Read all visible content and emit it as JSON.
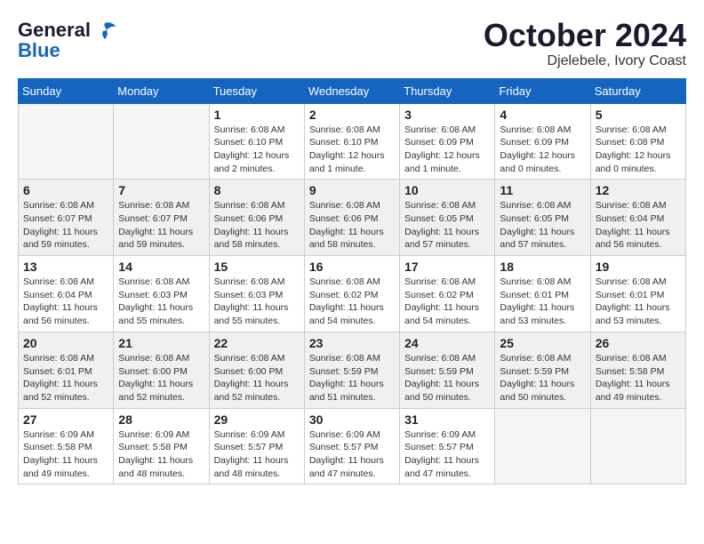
{
  "header": {
    "logo_line1": "General",
    "logo_line2": "Blue",
    "month": "October 2024",
    "location": "Djelebele, Ivory Coast"
  },
  "days_of_week": [
    "Sunday",
    "Monday",
    "Tuesday",
    "Wednesday",
    "Thursday",
    "Friday",
    "Saturday"
  ],
  "weeks": [
    [
      {
        "day": "",
        "sunrise": "",
        "sunset": "",
        "daylight": "",
        "empty": true
      },
      {
        "day": "",
        "sunrise": "",
        "sunset": "",
        "daylight": "",
        "empty": true
      },
      {
        "day": "1",
        "sunrise": "Sunrise: 6:08 AM",
        "sunset": "Sunset: 6:10 PM",
        "daylight": "Daylight: 12 hours and 2 minutes.",
        "empty": false
      },
      {
        "day": "2",
        "sunrise": "Sunrise: 6:08 AM",
        "sunset": "Sunset: 6:10 PM",
        "daylight": "Daylight: 12 hours and 1 minute.",
        "empty": false
      },
      {
        "day": "3",
        "sunrise": "Sunrise: 6:08 AM",
        "sunset": "Sunset: 6:09 PM",
        "daylight": "Daylight: 12 hours and 1 minute.",
        "empty": false
      },
      {
        "day": "4",
        "sunrise": "Sunrise: 6:08 AM",
        "sunset": "Sunset: 6:09 PM",
        "daylight": "Daylight: 12 hours and 0 minutes.",
        "empty": false
      },
      {
        "day": "5",
        "sunrise": "Sunrise: 6:08 AM",
        "sunset": "Sunset: 6:08 PM",
        "daylight": "Daylight: 12 hours and 0 minutes.",
        "empty": false
      }
    ],
    [
      {
        "day": "6",
        "sunrise": "Sunrise: 6:08 AM",
        "sunset": "Sunset: 6:07 PM",
        "daylight": "Daylight: 11 hours and 59 minutes.",
        "empty": false
      },
      {
        "day": "7",
        "sunrise": "Sunrise: 6:08 AM",
        "sunset": "Sunset: 6:07 PM",
        "daylight": "Daylight: 11 hours and 59 minutes.",
        "empty": false
      },
      {
        "day": "8",
        "sunrise": "Sunrise: 6:08 AM",
        "sunset": "Sunset: 6:06 PM",
        "daylight": "Daylight: 11 hours and 58 minutes.",
        "empty": false
      },
      {
        "day": "9",
        "sunrise": "Sunrise: 6:08 AM",
        "sunset": "Sunset: 6:06 PM",
        "daylight": "Daylight: 11 hours and 58 minutes.",
        "empty": false
      },
      {
        "day": "10",
        "sunrise": "Sunrise: 6:08 AM",
        "sunset": "Sunset: 6:05 PM",
        "daylight": "Daylight: 11 hours and 57 minutes.",
        "empty": false
      },
      {
        "day": "11",
        "sunrise": "Sunrise: 6:08 AM",
        "sunset": "Sunset: 6:05 PM",
        "daylight": "Daylight: 11 hours and 57 minutes.",
        "empty": false
      },
      {
        "day": "12",
        "sunrise": "Sunrise: 6:08 AM",
        "sunset": "Sunset: 6:04 PM",
        "daylight": "Daylight: 11 hours and 56 minutes.",
        "empty": false
      }
    ],
    [
      {
        "day": "13",
        "sunrise": "Sunrise: 6:08 AM",
        "sunset": "Sunset: 6:04 PM",
        "daylight": "Daylight: 11 hours and 56 minutes.",
        "empty": false
      },
      {
        "day": "14",
        "sunrise": "Sunrise: 6:08 AM",
        "sunset": "Sunset: 6:03 PM",
        "daylight": "Daylight: 11 hours and 55 minutes.",
        "empty": false
      },
      {
        "day": "15",
        "sunrise": "Sunrise: 6:08 AM",
        "sunset": "Sunset: 6:03 PM",
        "daylight": "Daylight: 11 hours and 55 minutes.",
        "empty": false
      },
      {
        "day": "16",
        "sunrise": "Sunrise: 6:08 AM",
        "sunset": "Sunset: 6:02 PM",
        "daylight": "Daylight: 11 hours and 54 minutes.",
        "empty": false
      },
      {
        "day": "17",
        "sunrise": "Sunrise: 6:08 AM",
        "sunset": "Sunset: 6:02 PM",
        "daylight": "Daylight: 11 hours and 54 minutes.",
        "empty": false
      },
      {
        "day": "18",
        "sunrise": "Sunrise: 6:08 AM",
        "sunset": "Sunset: 6:01 PM",
        "daylight": "Daylight: 11 hours and 53 minutes.",
        "empty": false
      },
      {
        "day": "19",
        "sunrise": "Sunrise: 6:08 AM",
        "sunset": "Sunset: 6:01 PM",
        "daylight": "Daylight: 11 hours and 53 minutes.",
        "empty": false
      }
    ],
    [
      {
        "day": "20",
        "sunrise": "Sunrise: 6:08 AM",
        "sunset": "Sunset: 6:01 PM",
        "daylight": "Daylight: 11 hours and 52 minutes.",
        "empty": false
      },
      {
        "day": "21",
        "sunrise": "Sunrise: 6:08 AM",
        "sunset": "Sunset: 6:00 PM",
        "daylight": "Daylight: 11 hours and 52 minutes.",
        "empty": false
      },
      {
        "day": "22",
        "sunrise": "Sunrise: 6:08 AM",
        "sunset": "Sunset: 6:00 PM",
        "daylight": "Daylight: 11 hours and 52 minutes.",
        "empty": false
      },
      {
        "day": "23",
        "sunrise": "Sunrise: 6:08 AM",
        "sunset": "Sunset: 5:59 PM",
        "daylight": "Daylight: 11 hours and 51 minutes.",
        "empty": false
      },
      {
        "day": "24",
        "sunrise": "Sunrise: 6:08 AM",
        "sunset": "Sunset: 5:59 PM",
        "daylight": "Daylight: 11 hours and 50 minutes.",
        "empty": false
      },
      {
        "day": "25",
        "sunrise": "Sunrise: 6:08 AM",
        "sunset": "Sunset: 5:59 PM",
        "daylight": "Daylight: 11 hours and 50 minutes.",
        "empty": false
      },
      {
        "day": "26",
        "sunrise": "Sunrise: 6:08 AM",
        "sunset": "Sunset: 5:58 PM",
        "daylight": "Daylight: 11 hours and 49 minutes.",
        "empty": false
      }
    ],
    [
      {
        "day": "27",
        "sunrise": "Sunrise: 6:09 AM",
        "sunset": "Sunset: 5:58 PM",
        "daylight": "Daylight: 11 hours and 49 minutes.",
        "empty": false
      },
      {
        "day": "28",
        "sunrise": "Sunrise: 6:09 AM",
        "sunset": "Sunset: 5:58 PM",
        "daylight": "Daylight: 11 hours and 48 minutes.",
        "empty": false
      },
      {
        "day": "29",
        "sunrise": "Sunrise: 6:09 AM",
        "sunset": "Sunset: 5:57 PM",
        "daylight": "Daylight: 11 hours and 48 minutes.",
        "empty": false
      },
      {
        "day": "30",
        "sunrise": "Sunrise: 6:09 AM",
        "sunset": "Sunset: 5:57 PM",
        "daylight": "Daylight: 11 hours and 47 minutes.",
        "empty": false
      },
      {
        "day": "31",
        "sunrise": "Sunrise: 6:09 AM",
        "sunset": "Sunset: 5:57 PM",
        "daylight": "Daylight: 11 hours and 47 minutes.",
        "empty": false
      },
      {
        "day": "",
        "sunrise": "",
        "sunset": "",
        "daylight": "",
        "empty": true
      },
      {
        "day": "",
        "sunrise": "",
        "sunset": "",
        "daylight": "",
        "empty": true
      }
    ]
  ]
}
